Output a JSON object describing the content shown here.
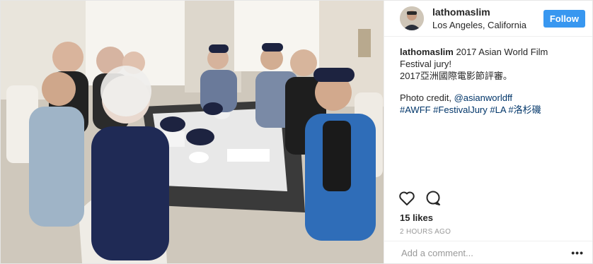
{
  "post": {
    "username": "lathomaslim",
    "location": "Los Angeles, California",
    "follow_label": "Follow"
  },
  "caption": {
    "username": "lathomaslim",
    "line1": "2017 Asian World Film Festival jury!",
    "line2": "2017亞洲國際電影節評審。",
    "credit_prefix": "Photo credit, ",
    "credit_mention": "@asianworldff",
    "hashtags": "#AWFF #FestivalJury #LA #洛杉磯"
  },
  "likes": "15 likes",
  "timestamp": "2 HOURS AGO",
  "comment": {
    "placeholder": "Add a comment..."
  },
  "colors": {
    "follow_button": "#3897f0",
    "link": "#003569"
  },
  "icons": [
    "heart-icon",
    "comment-icon",
    "more-options-icon"
  ]
}
